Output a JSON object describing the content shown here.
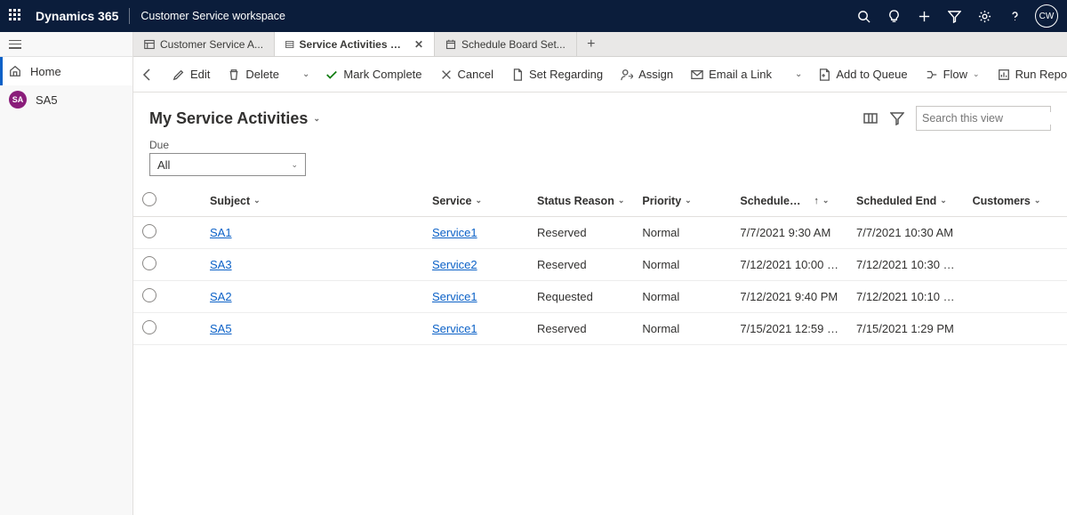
{
  "topbar": {
    "brand": "Dynamics 365",
    "app": "Customer Service workspace",
    "avatar": "CW"
  },
  "leftnav": {
    "home": "Home",
    "item2": "SA5",
    "item2_badge": "SA"
  },
  "tabs": {
    "t0": "Customer Service A...",
    "t1": "Service Activities My Ser...",
    "t2": "Schedule Board Set..."
  },
  "cmd": {
    "edit": "Edit",
    "delete": "Delete",
    "mark_complete": "Mark Complete",
    "cancel": "Cancel",
    "set_regarding": "Set Regarding",
    "assign": "Assign",
    "email_link": "Email a Link",
    "add_queue": "Add to Queue",
    "flow": "Flow",
    "run_report": "Run Report"
  },
  "page": {
    "title": "My Service Activities",
    "search_placeholder": "Search this view"
  },
  "due": {
    "label": "Due",
    "value": "All"
  },
  "columns": {
    "subject": "Subject",
    "service": "Service",
    "status": "Status Reason",
    "priority": "Priority",
    "sched_start": "Schedule…",
    "sched_end": "Scheduled End",
    "customers": "Customers"
  },
  "rows": [
    {
      "subject": "SA1",
      "service": "Service1",
      "status": "Reserved",
      "priority": "Normal",
      "start": "7/7/2021 9:30 AM",
      "end": "7/7/2021 10:30 AM",
      "customers": ""
    },
    {
      "subject": "SA3",
      "service": "Service2",
      "status": "Reserved",
      "priority": "Normal",
      "start": "7/12/2021 10:00 …",
      "end": "7/12/2021 10:30 …",
      "customers": ""
    },
    {
      "subject": "SA2",
      "service": "Service1",
      "status": "Requested",
      "priority": "Normal",
      "start": "7/12/2021 9:40 PM",
      "end": "7/12/2021 10:10 …",
      "customers": ""
    },
    {
      "subject": "SA5",
      "service": "Service1",
      "status": "Reserved",
      "priority": "Normal",
      "start": "7/15/2021 12:59 …",
      "end": "7/15/2021 1:29 PM",
      "customers": ""
    }
  ]
}
